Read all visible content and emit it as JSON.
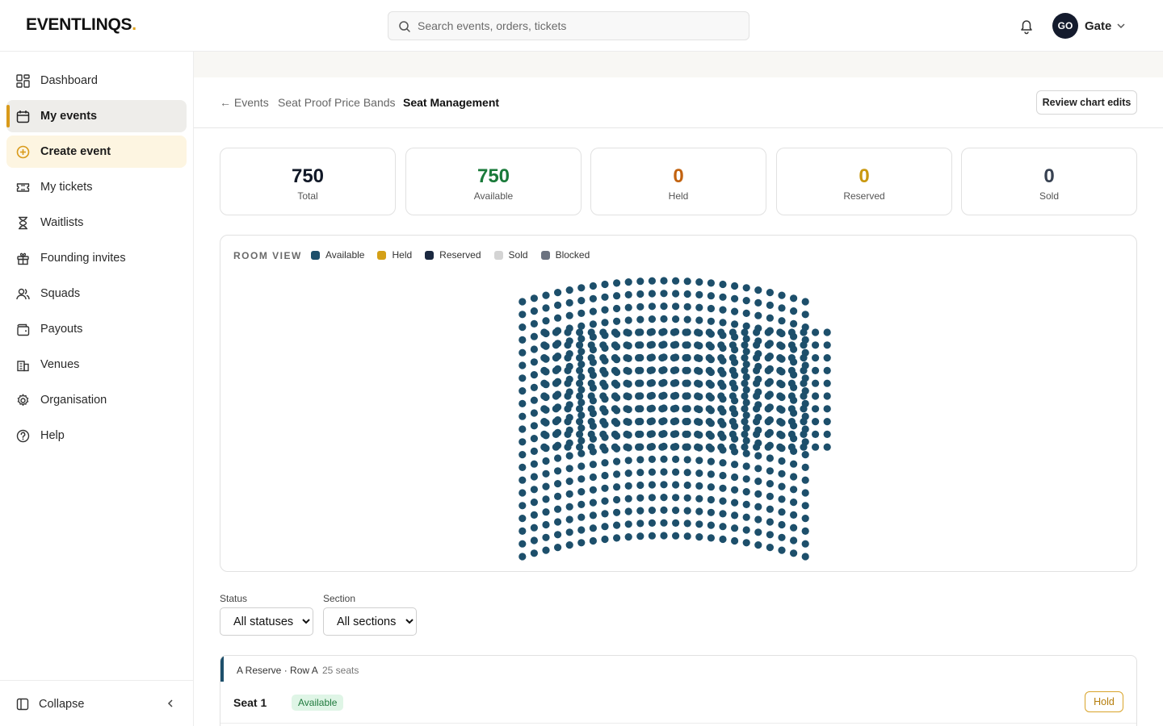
{
  "app": {
    "logo_text": "EVENTLINQS",
    "logo_dot": ".",
    "accent_color": "#e0a21b"
  },
  "header": {
    "search_placeholder": "Search events, orders, tickets",
    "user_initials": "GO",
    "user_name": "Gate",
    "icons": [
      "search-icon",
      "bell-icon",
      "chevron-down-icon"
    ]
  },
  "sidebar": {
    "items": [
      {
        "label": "Dashboard",
        "icon": "grid-icon"
      },
      {
        "label": "My events",
        "icon": "calendar-icon",
        "active": true
      },
      {
        "label": "Create event",
        "icon": "plus-circle-icon",
        "highlight": true
      },
      {
        "label": "My tickets",
        "icon": "ticket-icon"
      },
      {
        "label": "Waitlists",
        "icon": "hourglass-icon"
      },
      {
        "label": "Founding invites",
        "icon": "gift-icon"
      },
      {
        "label": "Squads",
        "icon": "users-icon"
      },
      {
        "label": "Payouts",
        "icon": "wallet-icon"
      },
      {
        "label": "Venues",
        "icon": "building-icon"
      },
      {
        "label": "Organisation",
        "icon": "gear-icon"
      },
      {
        "label": "Help",
        "icon": "help-circle-icon"
      }
    ],
    "collapse_label": "Collapse"
  },
  "breadcrumb": {
    "back": "← Events",
    "event": "Seat Proof Price Bands",
    "current": "Seat Management"
  },
  "actions": {
    "review_label": "Review chart edits"
  },
  "stats": [
    {
      "value": "750",
      "label": "Total",
      "color": "#111827"
    },
    {
      "value": "750",
      "label": "Available",
      "color": "#1a7a3a"
    },
    {
      "value": "0",
      "label": "Held",
      "color": "#c2620f"
    },
    {
      "value": "0",
      "label": "Reserved",
      "color": "#c9980f"
    },
    {
      "value": "0",
      "label": "Sold",
      "color": "#374151"
    }
  ],
  "room": {
    "title": "ROOM VIEW",
    "legend": [
      {
        "label": "Available",
        "color": "#1d4f6b"
      },
      {
        "label": "Held",
        "color": "#d4a017"
      },
      {
        "label": "Reserved",
        "color": "#1b2840"
      },
      {
        "label": "Sold",
        "color": "#d4d4d4"
      },
      {
        "label": "Blocked",
        "color": "#6b7280"
      }
    ],
    "seat_color": "#1d4f6b",
    "total_seats": 750,
    "rows": 30,
    "seats_per_row": 25
  },
  "filters": {
    "status_label": "Status",
    "status_value": "All statuses",
    "section_label": "Section",
    "section_value": "All sections"
  },
  "row_group": {
    "header": "A Reserve · Row A",
    "count": "25 seats",
    "seat": {
      "name": "Seat 1",
      "status": "Available",
      "action": "Hold"
    }
  }
}
